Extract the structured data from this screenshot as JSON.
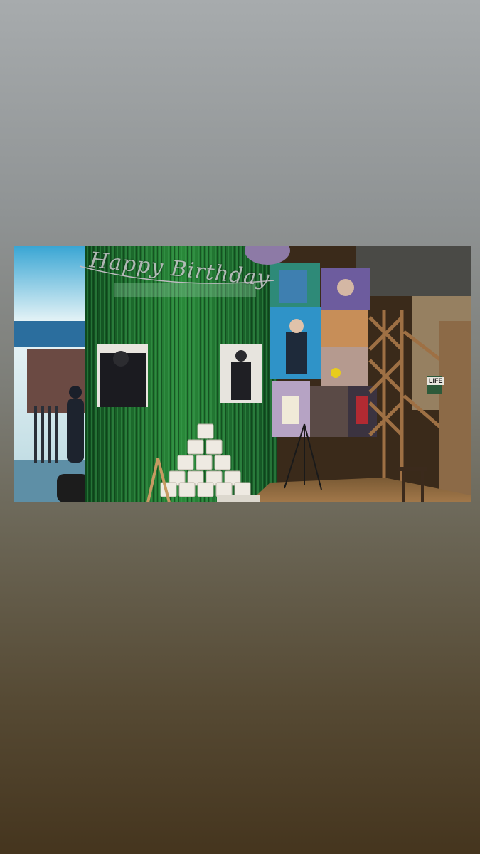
{
  "story": {
    "banner_text": "Happy Birthday",
    "sign_text": "LIFE"
  },
  "colors": {
    "background_top": "#a7abad",
    "background_bottom": "#45351e",
    "curtain": "#1f6b2c",
    "balloon": "#8d7aa6"
  }
}
